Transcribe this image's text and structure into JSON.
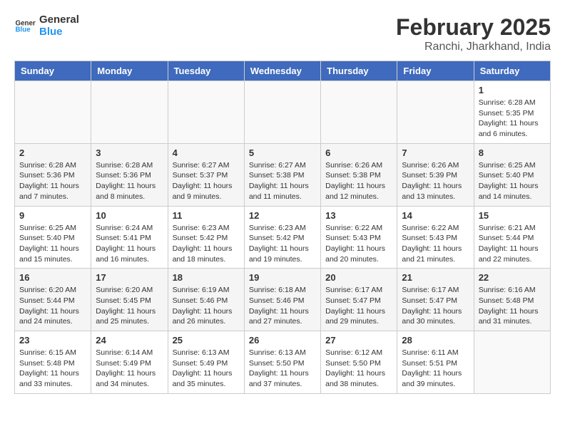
{
  "header": {
    "logo_line1": "General",
    "logo_line2": "Blue",
    "month": "February 2025",
    "location": "Ranchi, Jharkhand, India"
  },
  "weekdays": [
    "Sunday",
    "Monday",
    "Tuesday",
    "Wednesday",
    "Thursday",
    "Friday",
    "Saturday"
  ],
  "weeks": [
    [
      {
        "day": "",
        "info": ""
      },
      {
        "day": "",
        "info": ""
      },
      {
        "day": "",
        "info": ""
      },
      {
        "day": "",
        "info": ""
      },
      {
        "day": "",
        "info": ""
      },
      {
        "day": "",
        "info": ""
      },
      {
        "day": "1",
        "info": "Sunrise: 6:28 AM\nSunset: 5:35 PM\nDaylight: 11 hours and 6 minutes."
      }
    ],
    [
      {
        "day": "2",
        "info": "Sunrise: 6:28 AM\nSunset: 5:36 PM\nDaylight: 11 hours and 7 minutes."
      },
      {
        "day": "3",
        "info": "Sunrise: 6:28 AM\nSunset: 5:36 PM\nDaylight: 11 hours and 8 minutes."
      },
      {
        "day": "4",
        "info": "Sunrise: 6:27 AM\nSunset: 5:37 PM\nDaylight: 11 hours and 9 minutes."
      },
      {
        "day": "5",
        "info": "Sunrise: 6:27 AM\nSunset: 5:38 PM\nDaylight: 11 hours and 11 minutes."
      },
      {
        "day": "6",
        "info": "Sunrise: 6:26 AM\nSunset: 5:38 PM\nDaylight: 11 hours and 12 minutes."
      },
      {
        "day": "7",
        "info": "Sunrise: 6:26 AM\nSunset: 5:39 PM\nDaylight: 11 hours and 13 minutes."
      },
      {
        "day": "8",
        "info": "Sunrise: 6:25 AM\nSunset: 5:40 PM\nDaylight: 11 hours and 14 minutes."
      }
    ],
    [
      {
        "day": "9",
        "info": "Sunrise: 6:25 AM\nSunset: 5:40 PM\nDaylight: 11 hours and 15 minutes."
      },
      {
        "day": "10",
        "info": "Sunrise: 6:24 AM\nSunset: 5:41 PM\nDaylight: 11 hours and 16 minutes."
      },
      {
        "day": "11",
        "info": "Sunrise: 6:23 AM\nSunset: 5:42 PM\nDaylight: 11 hours and 18 minutes."
      },
      {
        "day": "12",
        "info": "Sunrise: 6:23 AM\nSunset: 5:42 PM\nDaylight: 11 hours and 19 minutes."
      },
      {
        "day": "13",
        "info": "Sunrise: 6:22 AM\nSunset: 5:43 PM\nDaylight: 11 hours and 20 minutes."
      },
      {
        "day": "14",
        "info": "Sunrise: 6:22 AM\nSunset: 5:43 PM\nDaylight: 11 hours and 21 minutes."
      },
      {
        "day": "15",
        "info": "Sunrise: 6:21 AM\nSunset: 5:44 PM\nDaylight: 11 hours and 22 minutes."
      }
    ],
    [
      {
        "day": "16",
        "info": "Sunrise: 6:20 AM\nSunset: 5:44 PM\nDaylight: 11 hours and 24 minutes."
      },
      {
        "day": "17",
        "info": "Sunrise: 6:20 AM\nSunset: 5:45 PM\nDaylight: 11 hours and 25 minutes."
      },
      {
        "day": "18",
        "info": "Sunrise: 6:19 AM\nSunset: 5:46 PM\nDaylight: 11 hours and 26 minutes."
      },
      {
        "day": "19",
        "info": "Sunrise: 6:18 AM\nSunset: 5:46 PM\nDaylight: 11 hours and 27 minutes."
      },
      {
        "day": "20",
        "info": "Sunrise: 6:17 AM\nSunset: 5:47 PM\nDaylight: 11 hours and 29 minutes."
      },
      {
        "day": "21",
        "info": "Sunrise: 6:17 AM\nSunset: 5:47 PM\nDaylight: 11 hours and 30 minutes."
      },
      {
        "day": "22",
        "info": "Sunrise: 6:16 AM\nSunset: 5:48 PM\nDaylight: 11 hours and 31 minutes."
      }
    ],
    [
      {
        "day": "23",
        "info": "Sunrise: 6:15 AM\nSunset: 5:48 PM\nDaylight: 11 hours and 33 minutes."
      },
      {
        "day": "24",
        "info": "Sunrise: 6:14 AM\nSunset: 5:49 PM\nDaylight: 11 hours and 34 minutes."
      },
      {
        "day": "25",
        "info": "Sunrise: 6:13 AM\nSunset: 5:49 PM\nDaylight: 11 hours and 35 minutes."
      },
      {
        "day": "26",
        "info": "Sunrise: 6:13 AM\nSunset: 5:50 PM\nDaylight: 11 hours and 37 minutes."
      },
      {
        "day": "27",
        "info": "Sunrise: 6:12 AM\nSunset: 5:50 PM\nDaylight: 11 hours and 38 minutes."
      },
      {
        "day": "28",
        "info": "Sunrise: 6:11 AM\nSunset: 5:51 PM\nDaylight: 11 hours and 39 minutes."
      },
      {
        "day": "",
        "info": ""
      }
    ]
  ]
}
